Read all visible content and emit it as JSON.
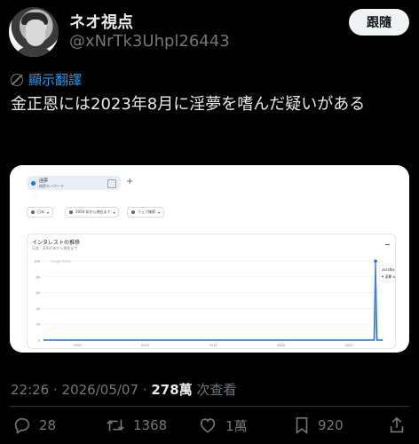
{
  "author": {
    "display_name": "ネオ視点",
    "handle": "@xNrTk3Uhpl26443",
    "follow_label": "跟隨"
  },
  "translate_label": "顯示翻譯",
  "tweet_text": "金正恩には2023年8月に淫夢を嗜んだ疑いがある",
  "media": {
    "search_term": "淫夢",
    "search_sub": "検索キーワード",
    "filters": [
      "日本",
      "2004 年から現在まで",
      "ウェブ検索"
    ],
    "card_title": "インタレストの推移",
    "card_subtitle": "日本 · 2004 年から現在まで",
    "source_note": "Google Trends",
    "tooltip_date": "2023年8月",
    "tooltip_value_label": "淫夢 100"
  },
  "chart_data": {
    "type": "line",
    "title": "インタレストの推移",
    "x_tick_labels": [
      "2006",
      "2010",
      "2014",
      "2018",
      "2022"
    ],
    "y_tick_labels": [
      "0",
      "20",
      "40",
      "60",
      "80",
      "100"
    ],
    "ylim": [
      0,
      100
    ],
    "series": [
      {
        "name": "淫夢",
        "points": [
          {
            "x": "2023-07",
            "y": 0
          },
          {
            "x": "2023-08",
            "y": 100
          },
          {
            "x": "2023-09",
            "y": 0
          }
        ]
      }
    ],
    "baseline": 0,
    "colors": {
      "line": "#1a73e8"
    }
  },
  "meta": {
    "time": "22:26",
    "date": "2026/05/07",
    "views": "278萬",
    "views_label": "次查看"
  },
  "actions": {
    "reply_count": "28",
    "retweet_count": "1368",
    "like_count": "1萬",
    "bookmark_count": "920"
  }
}
